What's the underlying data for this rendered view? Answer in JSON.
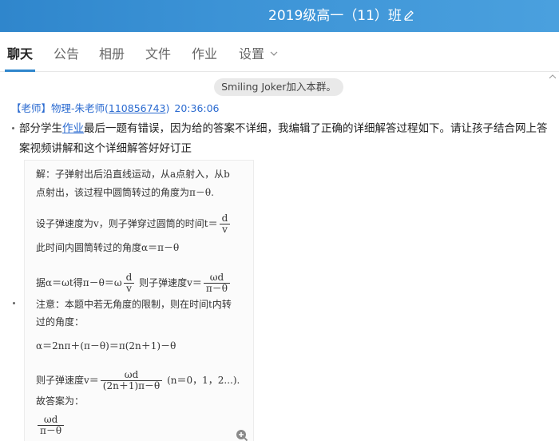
{
  "header": {
    "group_title": "2019级高一（11）班"
  },
  "tabs": [
    {
      "label": "聊天",
      "active": true
    },
    {
      "label": "公告",
      "active": false
    },
    {
      "label": "相册",
      "active": false
    },
    {
      "label": "文件",
      "active": false
    },
    {
      "label": "作业",
      "active": false
    },
    {
      "label": "设置",
      "active": false,
      "has_dropdown": true
    }
  ],
  "system_notice": "Smiling Joker加入本群。",
  "message": {
    "role": "【老师】",
    "sender": "物理-朱老师(",
    "qq": "110856743",
    "sender_close": ")",
    "time": "20:36:06",
    "text_before": "部分学生",
    "text_link": "作业",
    "text_after": "最后一题有错误，因为给的答案不详细，我编辑了正确的详细解答过程如下。请让孩子结合网上答案视频讲解和这个详细解答好好订正"
  },
  "solution": {
    "l1": "解：子弹射出后沿直线运动，从a点射入，从b",
    "l2": "点射出，该过程中圆筒转过的角度为π－θ.",
    "l3": "设子弹速度为v，则子弹穿过圆筒的时间t＝",
    "l3_num": "d",
    "l3_den": "v",
    "l4": "此时间内圆筒转过的角度α＝π－θ",
    "l5a": "据α＝ωt得π－θ＝ω",
    "l5_num": "d",
    "l5_den": "v",
    "l5b": "则子弹速度v＝",
    "l5_num2": "ωd",
    "l5_den2": "π－θ",
    "l6": "注意：本题中若无角度的限制，则在时间t内转",
    "l7": "过的角度：",
    "l8": "α＝2nπ＋(π－θ)＝π(2n＋1)－θ",
    "l9a": "则子弹速度v＝",
    "l9_num": "ωd",
    "l9_den": "(2n＋1)π－θ",
    "l9b": "(n＝0，1，2...).",
    "l10": "故答案为：",
    "l11_num": "ωd",
    "l11_den": "π－θ"
  },
  "colors": {
    "header_bg": "#3c93d6",
    "link": "#2a6ad0",
    "tab_active_underline": "#2f86cc"
  },
  "icons": [
    "edit-icon",
    "chevron-down-icon",
    "zoom-in-icon"
  ]
}
